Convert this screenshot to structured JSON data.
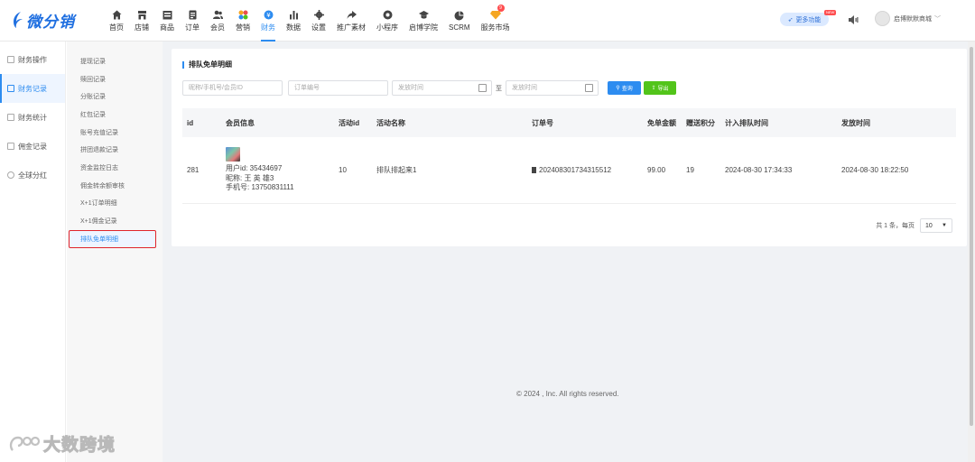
{
  "brand": {
    "name": "微分销",
    "accent": "#2d8cf0",
    "alert": "#e0242b"
  },
  "nav": [
    {
      "label": "首页",
      "icon": "home-icon"
    },
    {
      "label": "店铺",
      "icon": "store-icon"
    },
    {
      "label": "商品",
      "icon": "goods-icon"
    },
    {
      "label": "订单",
      "icon": "order-icon"
    },
    {
      "label": "会员",
      "icon": "member-icon"
    },
    {
      "label": "营销",
      "icon": "marketing-icon"
    },
    {
      "label": "财务",
      "icon": "finance-icon",
      "active": true
    },
    {
      "label": "数据",
      "icon": "chart-icon"
    },
    {
      "label": "设置",
      "icon": "gear-icon"
    },
    {
      "label": "推广素材",
      "icon": "share-icon"
    },
    {
      "label": "小程序",
      "icon": "miniapp-icon"
    },
    {
      "label": "启博学院",
      "icon": "academy-icon"
    },
    {
      "label": "SCRM",
      "icon": "scrm-icon"
    },
    {
      "label": "服务市场",
      "icon": "market-icon",
      "badge": "9"
    }
  ],
  "header": {
    "more_label": "更多功能",
    "new_tag": "NEW",
    "user_name": "启博默默商城"
  },
  "sidebar": [
    {
      "label": "财务操作"
    },
    {
      "label": "财务记录",
      "active": true
    },
    {
      "label": "财务统计"
    },
    {
      "label": "佣金记录"
    },
    {
      "label": "全球分红"
    }
  ],
  "submenu": [
    "提现记录",
    "赎回记录",
    "分账记录",
    "红包记录",
    "账号充值记录",
    "拼团退款记录",
    "资金监控日志",
    "佣金转余额审核",
    "X+1订单明细",
    "X+1佣金记录",
    "排队免单明细"
  ],
  "submenu_active": "排队免单明细",
  "page": {
    "title": "排队免单明细",
    "filters": {
      "member_placeholder": "昵称/手机号/会员ID",
      "order_placeholder": "订单编号",
      "start_placeholder": "发放时间",
      "to_label": "至",
      "end_placeholder": "发放时间",
      "query_label": "查询",
      "export_label": "导出"
    },
    "columns": [
      "id",
      "会员信息",
      "活动id",
      "活动名称",
      "订单号",
      "免单金额",
      "赠送积分",
      "计入排队时间",
      "发放时间"
    ],
    "rows": [
      {
        "id": "281",
        "user_id": "用户id: 35434697",
        "nickname": "昵称: 王 英 雄3",
        "phone": "手机号: 13750831111",
        "activity_id": "10",
        "activity_name": "排队排起来1",
        "order_no": "202408301734315512",
        "amount": "99.00",
        "points": "19",
        "queue_time": "2024-08-30 17:34:33",
        "issue_time": "2024-08-30 18:22:50"
      }
    ],
    "pager": {
      "total_text": "共 1 条，每页",
      "page_size": "10"
    }
  },
  "footer": "© 2024 , Inc. All rights reserved.",
  "watermark": "大数跨境"
}
